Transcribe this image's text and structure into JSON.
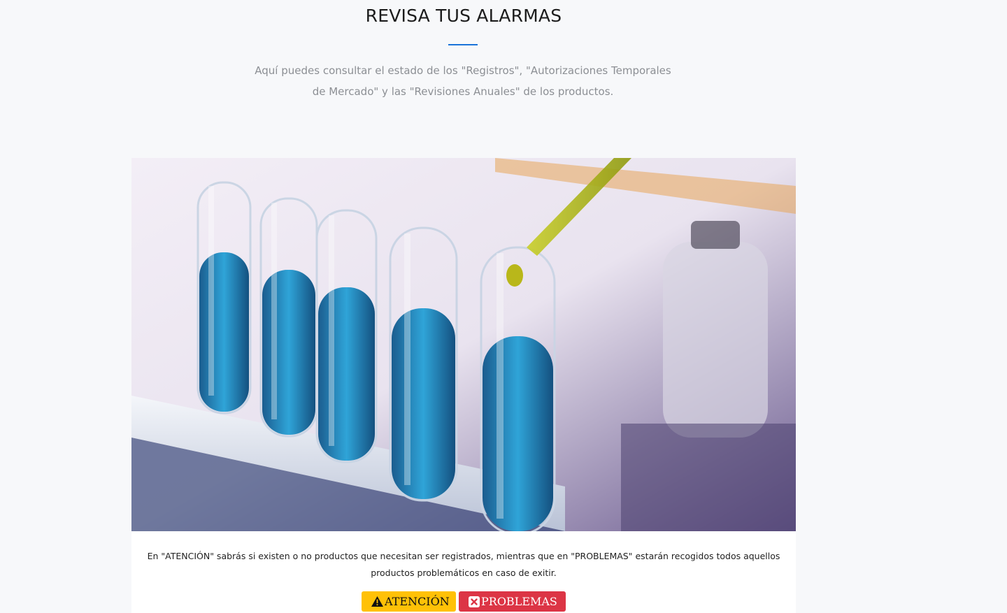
{
  "section": {
    "title": "REVISA TUS ALARMAS",
    "subtitle_line1": "Aquí puedes consultar el estado de los \"Registros\", \"Autorizaciones Temporales",
    "subtitle_line2": "de Mercado\" y las \"Revisiones Anuales\" de los productos."
  },
  "card": {
    "image_icon": "test-tubes-photo",
    "description_line1": "En \"ATENCIÓN\" sabrás si existen o no productos que necesitan ser registrados, mientras que en \"PROBLEMAS\" estarán recogidos todos aquellos",
    "description_line2": "productos problemáticos en caso de exitir.",
    "buttons": {
      "attention_label": "ATENCIÓN",
      "attention_icon": "warning-triangle-icon",
      "problems_label": "PROBLEMAS",
      "problems_icon": "close-box-icon"
    }
  },
  "colors": {
    "accent": "#1a73d9",
    "warning": "#ffc107",
    "danger": "#dc3545"
  }
}
